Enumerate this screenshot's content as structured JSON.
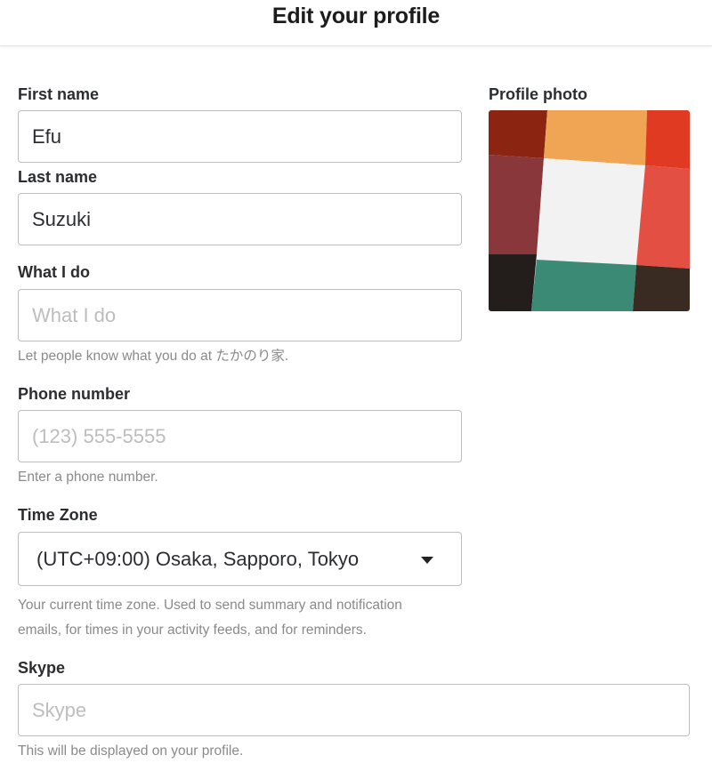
{
  "header": {
    "title": "Edit your profile"
  },
  "form": {
    "first_name": {
      "label": "First name",
      "value": "Efu"
    },
    "last_name": {
      "label": "Last name",
      "value": "Suzuki"
    },
    "what_i_do": {
      "label": "What I do",
      "value": "",
      "placeholder": "What I do",
      "help": "Let people know what you do at たかのり家."
    },
    "phone": {
      "label": "Phone number",
      "value": "",
      "placeholder": "(123) 555-5555",
      "help": "Enter a phone number."
    },
    "time_zone": {
      "label": "Time Zone",
      "selected": "(UTC+09:00) Osaka, Sapporo, Tokyo",
      "help_line1": "Your current time zone. Used to send summary and notification",
      "help_line2": "emails, for times in your activity feeds, and for reminders."
    },
    "skype": {
      "label": "Skype",
      "value": "",
      "placeholder": "Skype",
      "help": "This will be displayed on your profile."
    }
  },
  "profile_photo": {
    "label": "Profile photo",
    "colors": {
      "top_left": "#8b2411",
      "top_middle": "#f0a554",
      "top_right": "#e03b22",
      "mid_left": "#8a373b",
      "center": "#f2f2f2",
      "mid_right": "#e35043",
      "bottom_left": "#231e1b",
      "bottom_middle": "#3a8a76",
      "bottom_right": "#3a2b22"
    }
  }
}
